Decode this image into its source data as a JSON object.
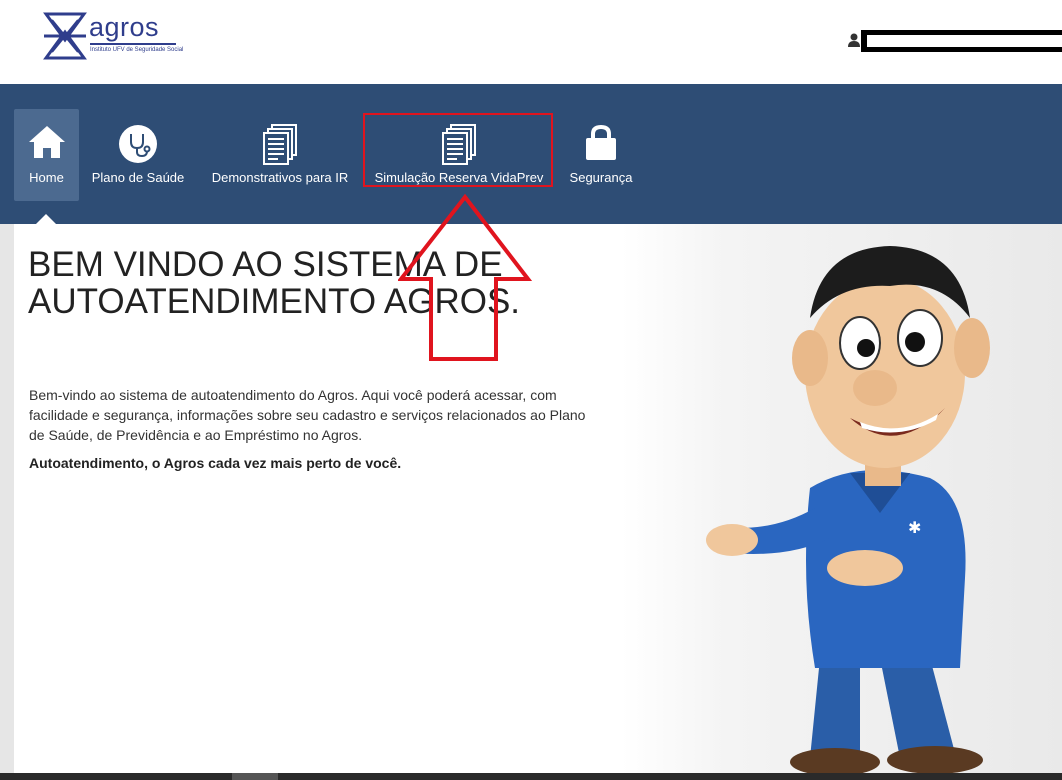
{
  "header": {
    "logo_text": "agros",
    "logo_subtitle": "Instituto UFV de Seguridade Social",
    "user_icon": "user-icon"
  },
  "nav": {
    "items": [
      {
        "label": "Home",
        "icon": "home-icon"
      },
      {
        "label": "Plano de Saúde",
        "icon": "stethoscope-icon"
      },
      {
        "label": "Demonstrativos para IR",
        "icon": "documents-icon"
      },
      {
        "label": "Simulação Reserva VidaPrev",
        "icon": "documents-icon"
      },
      {
        "label": "Segurança",
        "icon": "lock-icon"
      }
    ]
  },
  "main": {
    "title_line1": "BEM VINDO AO SISTEMA DE",
    "title_line2": "AUTOATENDIMENTO AGROS.",
    "paragraph": "Bem-vindo ao sistema de autoatendimento do Agros. Aqui você poderá acessar, com facilidade e segurança, informações sobre seu cadastro e serviços relacionados ao Plano de Saúde, de Previdência e ao Empréstimo no Agros.",
    "tagline": "Autoatendimento, o Agros cada vez mais perto de você."
  },
  "colors": {
    "nav_bg": "#2e4d75",
    "nav_active": "#4c6a90",
    "highlight_red": "#e0141e",
    "brand_blue": "#2f3d8c"
  }
}
